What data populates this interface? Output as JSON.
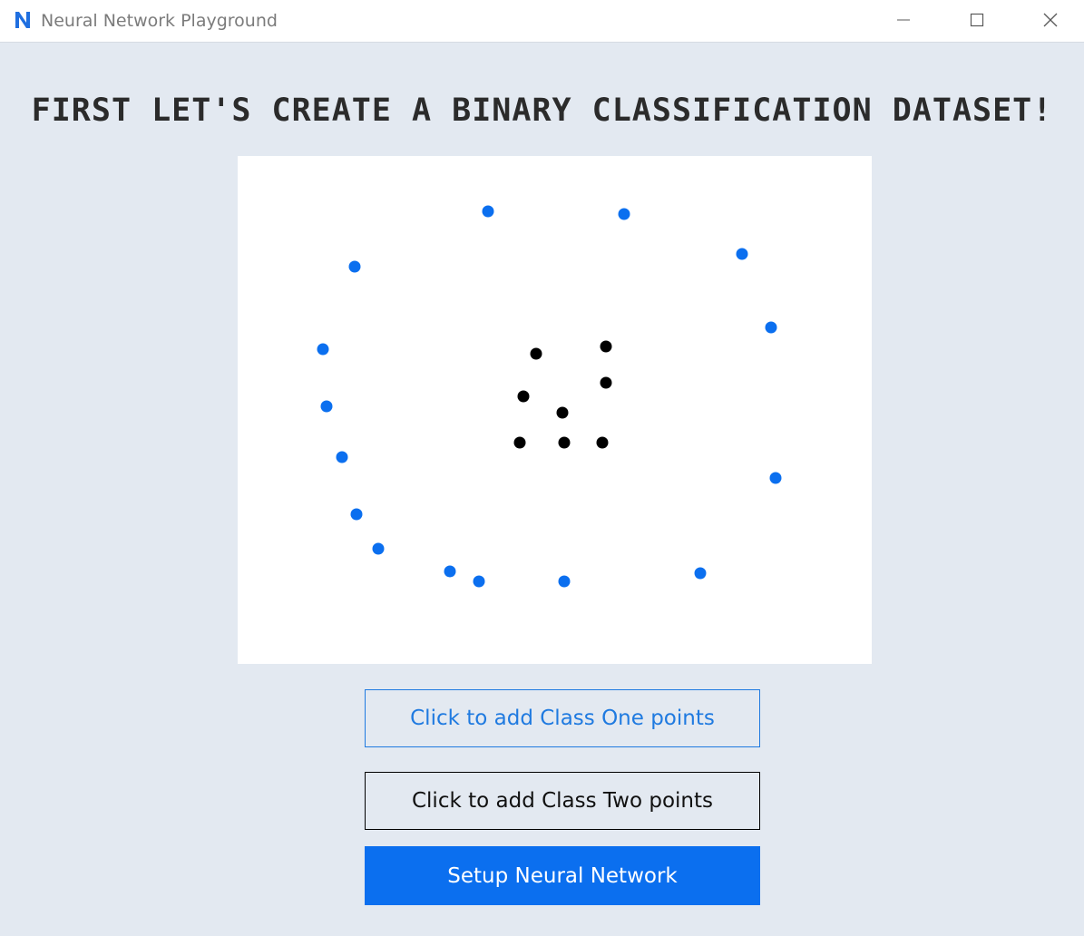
{
  "window": {
    "title": "Neural Network Playground",
    "logo_letter": "N",
    "controls": [
      "minimize-icon",
      "maximize-icon",
      "close-icon"
    ]
  },
  "heading": "First let's create a binary classification dataset!",
  "colors": {
    "background": "#e3e9f1",
    "class_one": "#0b6fef",
    "class_two": "#000000",
    "canvas": "#ffffff",
    "accent": "#0b6fef"
  },
  "buttons": {
    "class_one_label": "Click to add Class One points",
    "class_two_label": "Click to add Class Two points",
    "setup_label": "Setup Neural Network"
  },
  "dataset": {
    "class_one_points": [
      [
        276,
        61
      ],
      [
        426,
        64
      ],
      [
        556,
        108
      ],
      [
        129,
        122
      ],
      [
        588,
        189
      ],
      [
        94,
        213
      ],
      [
        98,
        276
      ],
      [
        115,
        332
      ],
      [
        593,
        355
      ],
      [
        131,
        395
      ],
      [
        155,
        433
      ],
      [
        234,
        458
      ],
      [
        266,
        469
      ],
      [
        360,
        469
      ],
      [
        510,
        460
      ]
    ],
    "class_two_points": [
      [
        406,
        210
      ],
      [
        329,
        218
      ],
      [
        406,
        250
      ],
      [
        315,
        265
      ],
      [
        358,
        283
      ],
      [
        311,
        316
      ],
      [
        360,
        316
      ],
      [
        402,
        316
      ]
    ]
  }
}
